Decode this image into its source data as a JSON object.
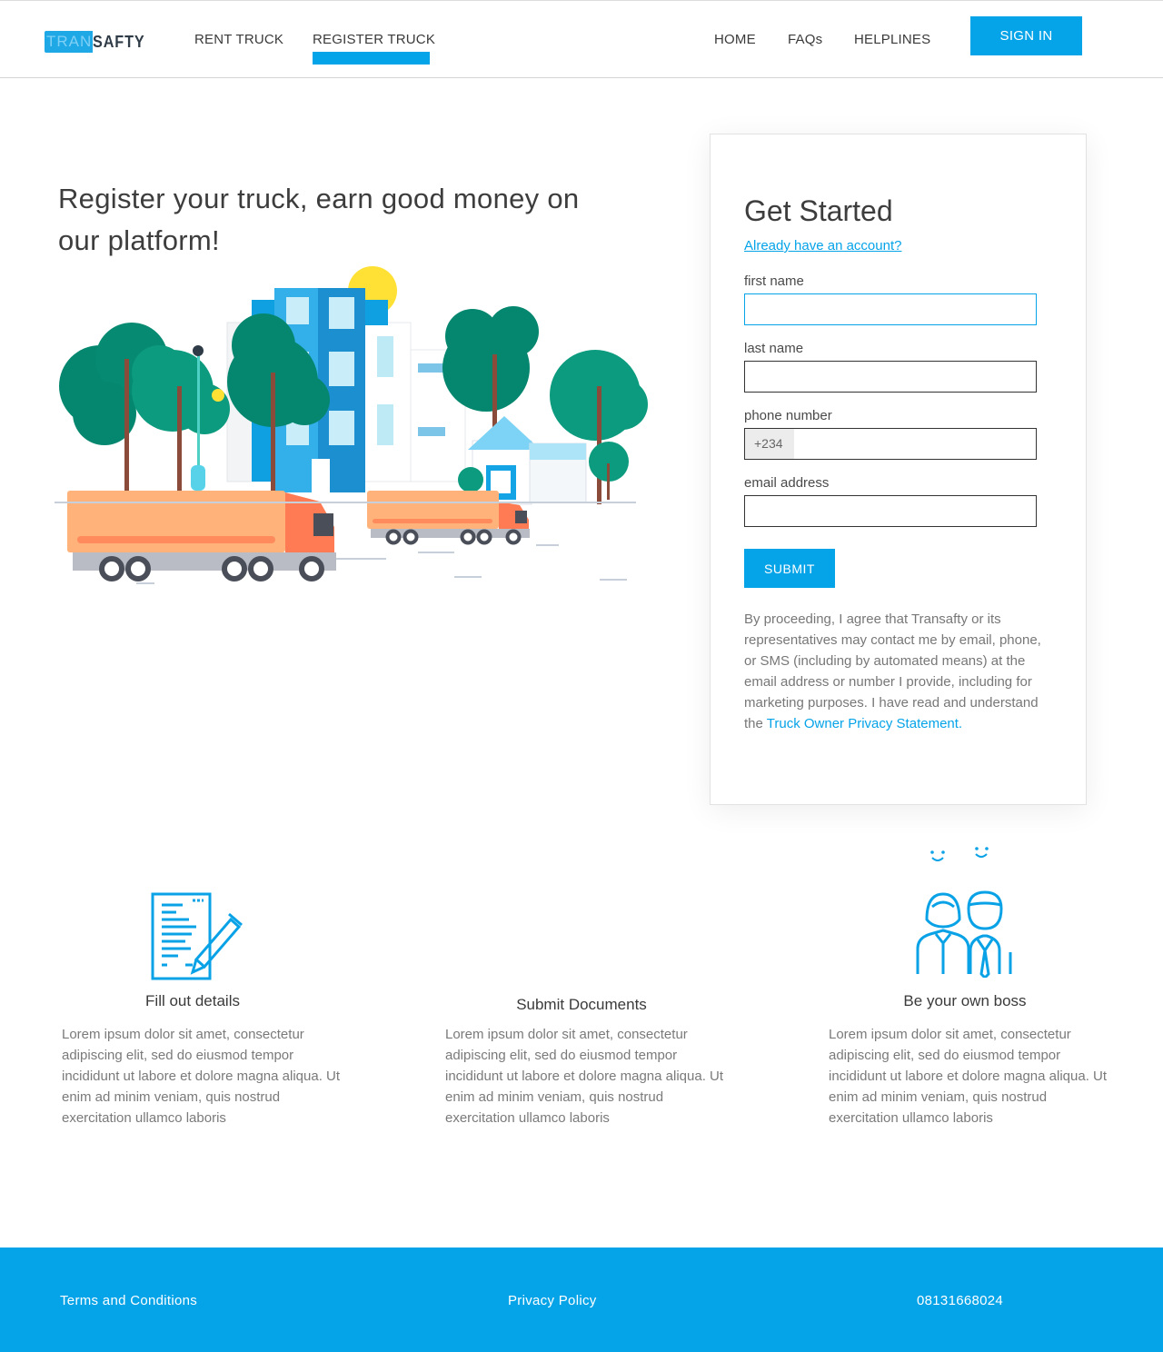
{
  "header": {
    "logo_part1": "TRAN",
    "logo_part2": "SAFTY",
    "nav_left": [
      "RENT TRUCK",
      "REGISTER TRUCK"
    ],
    "active_nav": "REGISTER TRUCK",
    "nav_right": [
      "HOME",
      "FAQs",
      "HELPLINES"
    ],
    "signin_label": "SIGN IN"
  },
  "hero": {
    "title": "Register your truck, earn good money on our platform!"
  },
  "form": {
    "title": "Get Started",
    "account_link": "Already have an account?",
    "first_name_label": "first name",
    "last_name_label": "last name",
    "phone_label": "phone number",
    "phone_prefix": "+234",
    "email_label": "email address",
    "submit_label": "SUBMIT",
    "consent_text": "By proceeding, I agree that Transafty or its representatives may contact me by email, phone, or SMS (including by automated means) at the email address or number I provide, including for marketing purposes. I have read and understand the ",
    "consent_link": "Truck Owner Privacy Statement."
  },
  "features": [
    {
      "title": "Fill out details",
      "text": "Lorem ipsum dolor sit amet, consectetur adipiscing elit, sed do eiusmod tempor incididunt ut labore et dolore magna aliqua. Ut enim ad minim veniam, quis nostrud exercitation ullamco laboris"
    },
    {
      "title": "Submit Documents",
      "text": "Lorem ipsum dolor sit amet, consectetur adipiscing elit, sed do eiusmod tempor incididunt ut labore et dolore magna aliqua. Ut enim ad minim veniam, quis nostrud exercitation ullamco laboris"
    },
    {
      "title": "Be your own boss",
      "text": "Lorem ipsum dolor sit amet, consectetur adipiscing elit, sed do eiusmod tempor incididunt ut labore et dolore magna aliqua. Ut enim ad minim veniam, quis nostrud exercitation ullamco laboris"
    }
  ],
  "footer": {
    "terms": "Terms and Conditions",
    "privacy": "Privacy Policy",
    "phone": "08131668024"
  },
  "colors": {
    "accent": "#05a3e8",
    "text": "#3d3d3d",
    "muted": "#7a7a7a"
  },
  "icons": [
    "document-pen-icon",
    "business-people-icon"
  ]
}
